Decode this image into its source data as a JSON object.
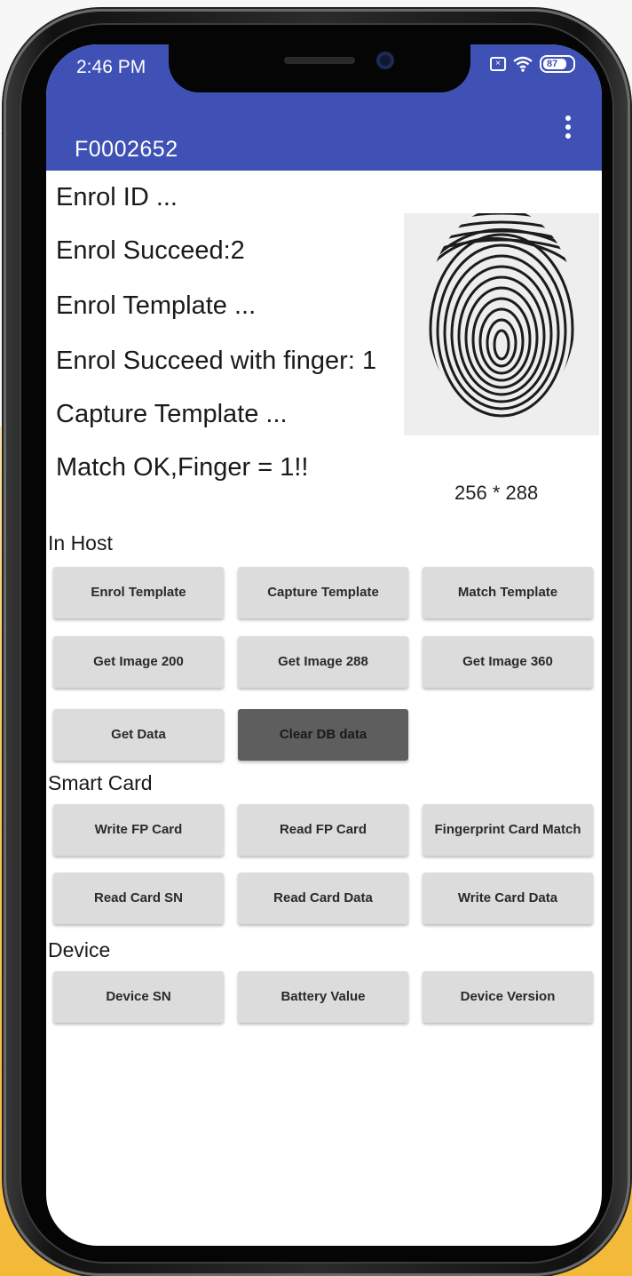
{
  "status_bar": {
    "time": "2:46 PM",
    "battery": "87",
    "icons": [
      "sim-icon",
      "wifi-icon",
      "battery-icon"
    ]
  },
  "app_bar": {
    "title": "F0002652",
    "menu_icon": "overflow-menu-icon",
    "color": "#3f51b5"
  },
  "log": [
    "Enrol ID ...",
    "Enrol Succeed:2",
    "Enrol Template ...",
    "Enrol Succeed with finger: 1",
    "Capture Template ...",
    "Match OK,Finger = 1!!"
  ],
  "fingerprint": {
    "size_label": "256 * 288"
  },
  "sections": {
    "host": {
      "label": "In Host",
      "buttons": [
        "Enrol Template",
        "Capture Template",
        "Match Template",
        "Get Image 200",
        "Get Image 288",
        "Get Image 360",
        "Get Data",
        "Clear DB data"
      ]
    },
    "smart_card": {
      "label": "Smart Card",
      "buttons": [
        "Write FP Card",
        "Read FP Card",
        "Fingerprint Card Match",
        "Read Card SN",
        "Read Card Data",
        "Write Card Data"
      ]
    },
    "device": {
      "label": "Device",
      "buttons": [
        "Device SN",
        "Battery Value",
        "Device Version"
      ]
    }
  }
}
